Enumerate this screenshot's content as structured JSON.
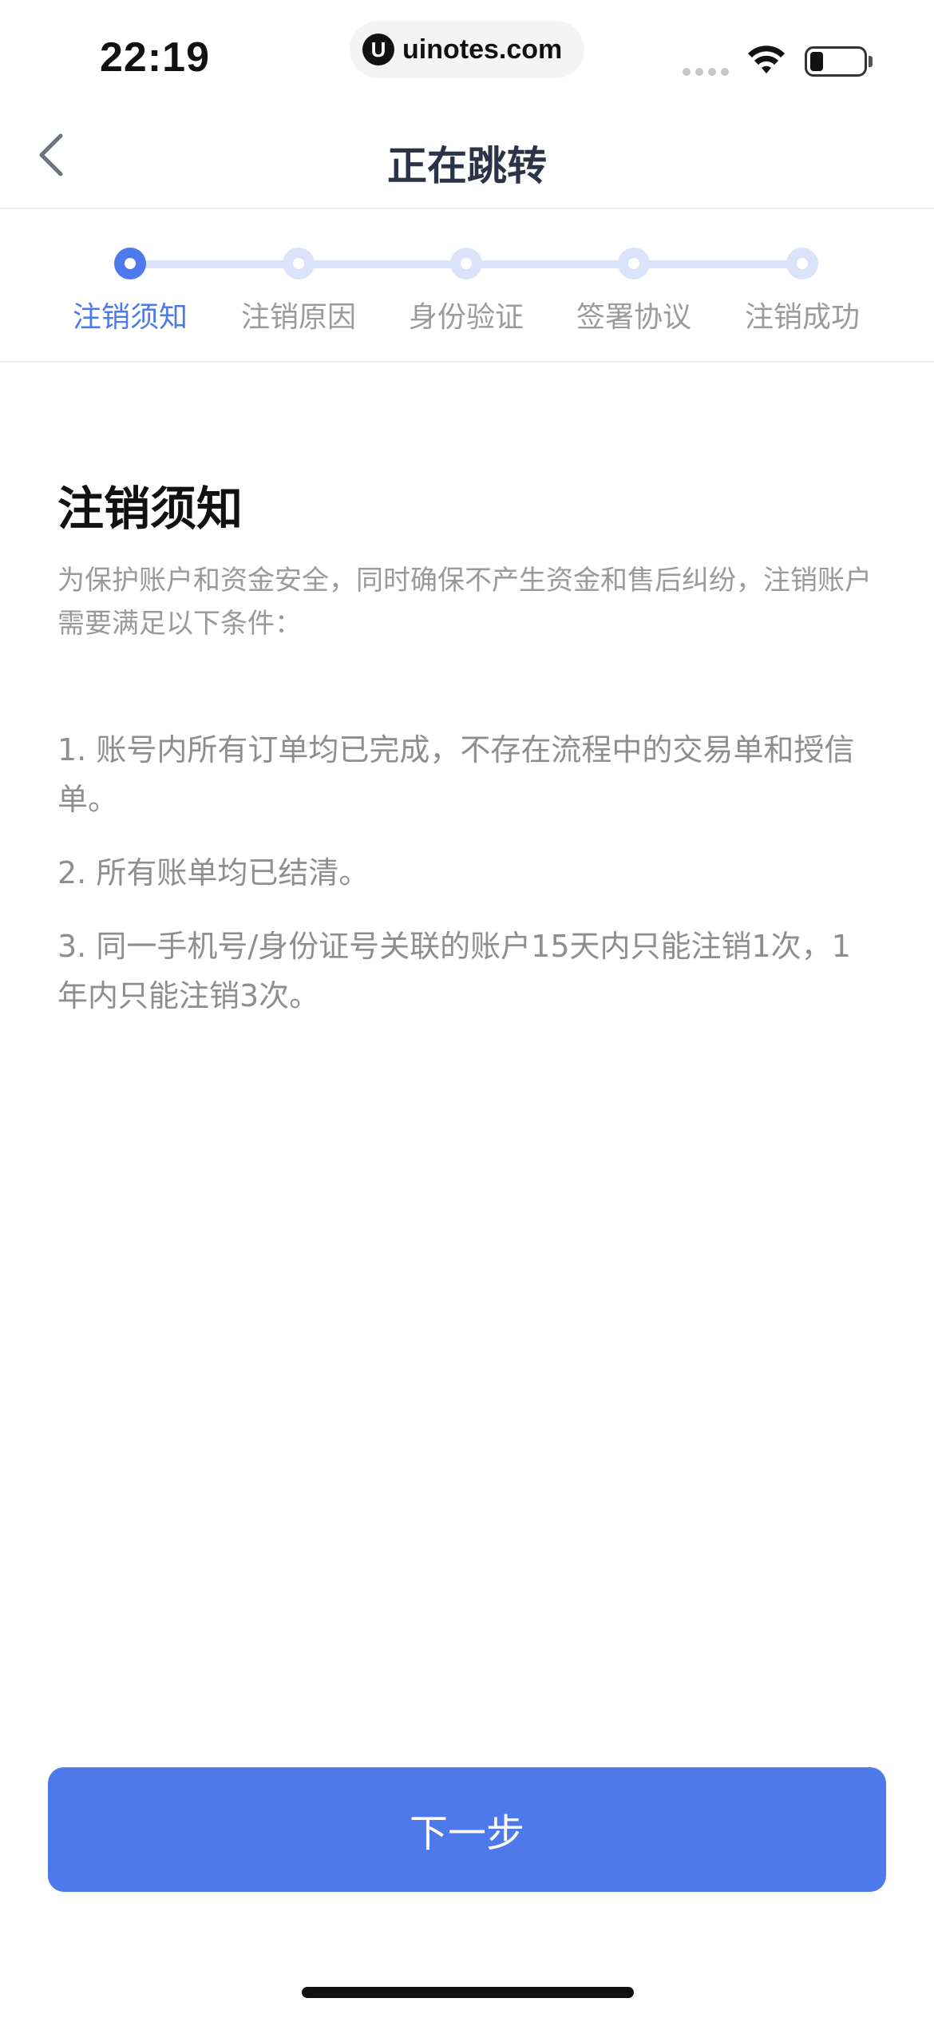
{
  "status_bar": {
    "time": "22:19",
    "url": "uinotes.com",
    "url_logo": "U",
    "icons": [
      "signal-icon",
      "wifi-icon",
      "battery-icon"
    ]
  },
  "nav": {
    "title": "正在跳转",
    "back_icon": "chevron-left-icon"
  },
  "steps": [
    {
      "label": "注销须知",
      "active": true
    },
    {
      "label": "注销原因",
      "active": false
    },
    {
      "label": "身份验证",
      "active": false
    },
    {
      "label": "签署协议",
      "active": false
    },
    {
      "label": "注销成功",
      "active": false
    }
  ],
  "notice": {
    "title": "注销须知",
    "intro": "为保护账户和资金安全，同时确保不产生资金和售后纠纷，注销账户需要满足以下条件：",
    "conditions": [
      "1. 账号内所有订单均已完成，不存在流程中的交易单和授信单。",
      "2. 所有账单均已结清。",
      "3. 同一手机号/身份证号关联的账户15天内只能注销1次，1年内只能注销3次。"
    ]
  },
  "footer": {
    "next_label": "下一步"
  },
  "colors": {
    "accent": "#4e79ea",
    "track": "#dbe3fa",
    "muted_text": "#9a9a9a",
    "title_text": "#2b3347"
  }
}
